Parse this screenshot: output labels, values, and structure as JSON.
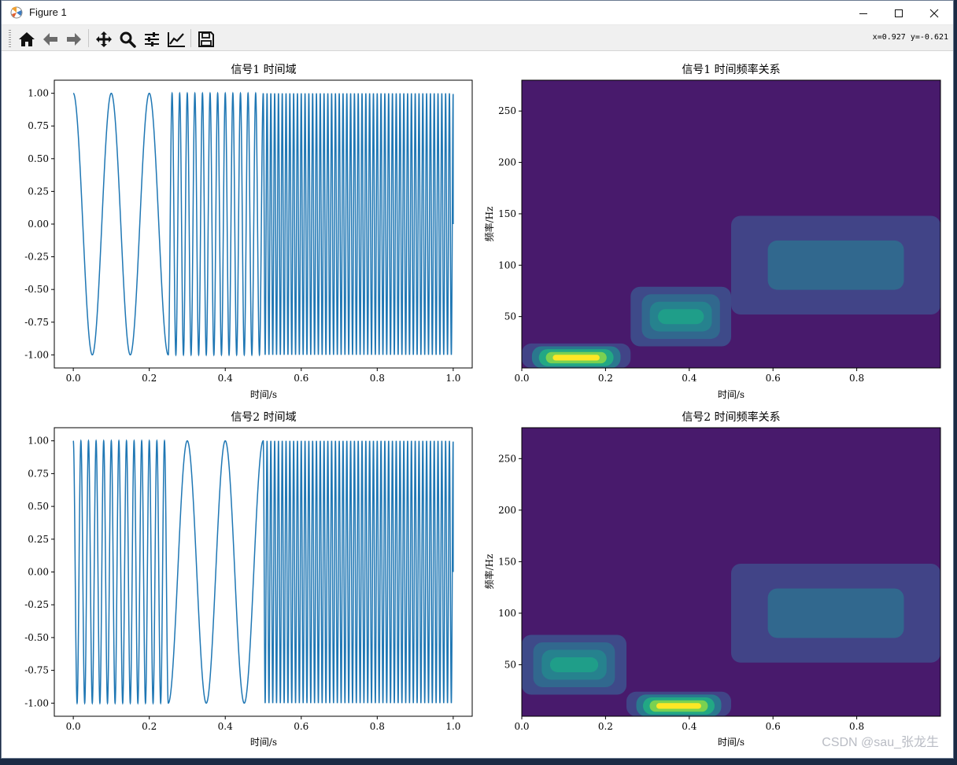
{
  "window": {
    "title": "Figure 1"
  },
  "toolbar": {
    "buttons": [
      {
        "icon": "home-icon"
      },
      {
        "icon": "back-arrow-icon"
      },
      {
        "icon": "forward-arrow-icon"
      },
      {
        "icon": "pan-move-icon"
      },
      {
        "icon": "zoom-magnifier-icon"
      },
      {
        "icon": "subplots-sliders-icon"
      },
      {
        "icon": "edit-axes-icon"
      },
      {
        "icon": "save-disk-icon"
      }
    ],
    "coords": "x=0.927 y=-0.621"
  },
  "colors": {
    "line": "#1f77b4",
    "viridis_dark": "#481a6c"
  },
  "watermark": "CSDN @sau_张龙生",
  "chart_data": [
    {
      "type": "line",
      "title": "信号1 时间域",
      "xlabel": "时间/s",
      "ylabel": "",
      "xlim": [
        -0.05,
        1.05
      ],
      "ylim": [
        -1.1,
        1.1
      ],
      "xticks": [
        "0.0",
        "0.2",
        "0.4",
        "0.6",
        "0.8",
        "1.0"
      ],
      "yticks": [
        "1.00",
        "0.75",
        "0.50",
        "0.25",
        "0.00",
        "-0.25",
        "-0.50",
        "-0.75",
        "-1.00"
      ],
      "signal": [
        {
          "t_start": 0.0,
          "t_end": 0.25,
          "freq_hz": 10
        },
        {
          "t_start": 0.25,
          "t_end": 0.5,
          "freq_hz": 50
        },
        {
          "t_start": 0.5,
          "t_end": 1.0,
          "freq_hz": 100
        }
      ]
    },
    {
      "type": "heatmap",
      "title": "信号1 时间频率关系",
      "xlabel": "时间/s",
      "ylabel": "频率/Hz",
      "xlim": [
        0,
        1
      ],
      "ylim": [
        0,
        280
      ],
      "xticks": [
        "0.0",
        "0.2",
        "0.4",
        "0.6",
        "0.8"
      ],
      "yticks": [
        "250",
        "200",
        "150",
        "100",
        "50"
      ],
      "bands": [
        {
          "t_start": 0.0,
          "t_end": 0.26,
          "freq_hz": 10,
          "intensity": "high"
        },
        {
          "t_start": 0.26,
          "t_end": 0.5,
          "freq_hz": 50,
          "intensity": "medium"
        },
        {
          "t_start": 0.5,
          "t_end": 1.0,
          "freq_hz": 100,
          "intensity": "low"
        }
      ]
    },
    {
      "type": "line",
      "title": "信号2 时间域",
      "xlabel": "时间/s",
      "ylabel": "",
      "xlim": [
        -0.05,
        1.05
      ],
      "ylim": [
        -1.1,
        1.1
      ],
      "xticks": [
        "0.0",
        "0.2",
        "0.4",
        "0.6",
        "0.8",
        "1.0"
      ],
      "yticks": [
        "1.00",
        "0.75",
        "0.50",
        "0.25",
        "0.00",
        "-0.25",
        "-0.50",
        "-0.75",
        "-1.00"
      ],
      "signal": [
        {
          "t_start": 0.0,
          "t_end": 0.25,
          "freq_hz": 50
        },
        {
          "t_start": 0.25,
          "t_end": 0.5,
          "freq_hz": 10
        },
        {
          "t_start": 0.5,
          "t_end": 1.0,
          "freq_hz": 100
        }
      ]
    },
    {
      "type": "heatmap",
      "title": "信号2 时间频率关系",
      "xlabel": "时间/s",
      "ylabel": "频率/Hz",
      "xlim": [
        0,
        1
      ],
      "ylim": [
        0,
        280
      ],
      "xticks": [
        "0.0",
        "0.2",
        "0.4",
        "0.6",
        "0.8"
      ],
      "yticks": [
        "250",
        "200",
        "150",
        "100",
        "50"
      ],
      "bands": [
        {
          "t_start": 0.0,
          "t_end": 0.25,
          "freq_hz": 50,
          "intensity": "medium"
        },
        {
          "t_start": 0.25,
          "t_end": 0.5,
          "freq_hz": 10,
          "intensity": "high"
        },
        {
          "t_start": 0.5,
          "t_end": 1.0,
          "freq_hz": 100,
          "intensity": "low"
        }
      ]
    }
  ]
}
